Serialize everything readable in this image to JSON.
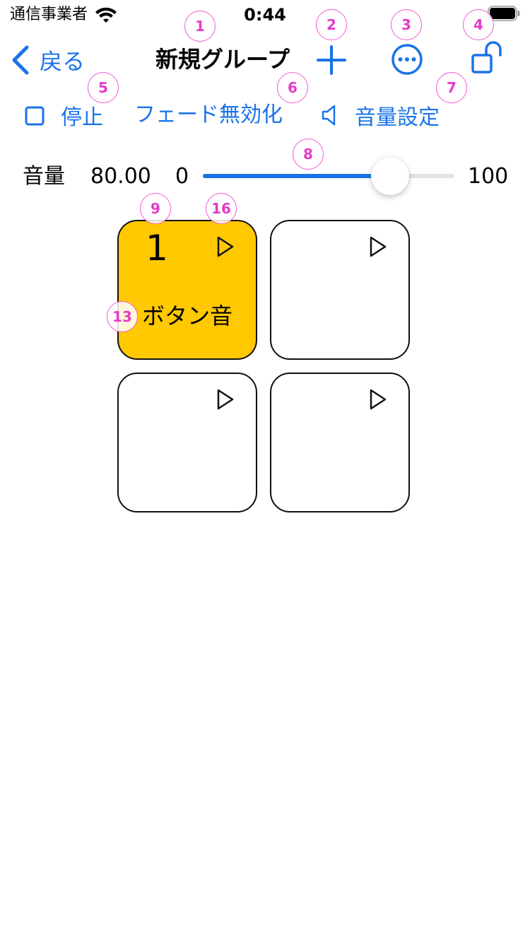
{
  "status_bar": {
    "carrier": "通信事業者",
    "time": "0:44"
  },
  "nav": {
    "back_label": "戻る",
    "title": "新規グループ"
  },
  "toolbar": {
    "stop_label": "停止",
    "fade_label": "フェード無効化",
    "volume_settings_label": "音量設定"
  },
  "volume": {
    "label": "音量",
    "value_text": "80.00",
    "min_label": "0",
    "max_label": "100",
    "fraction": 0.745
  },
  "tiles": [
    {
      "number": "1",
      "label": "ボタン音",
      "active": true
    },
    {
      "number": "",
      "label": "",
      "active": false
    },
    {
      "number": "",
      "label": "",
      "active": false
    },
    {
      "number": "",
      "label": "",
      "active": false
    }
  ],
  "markers": [
    "1",
    "2",
    "3",
    "4",
    "5",
    "6",
    "7",
    "8",
    "9",
    "16",
    "13"
  ],
  "colors": {
    "accent": "#1a73e8",
    "tile_active": "#ffc800",
    "marker": "#f25bd6"
  }
}
